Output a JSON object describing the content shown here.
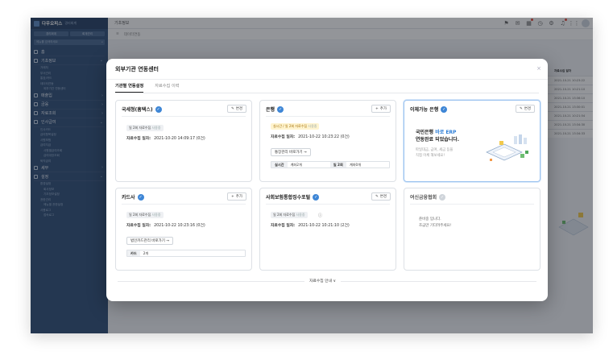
{
  "app": {
    "brand": "다우오피스",
    "brand_sub": "경리회계",
    "tabs": [
      "경리회계",
      "회계관리"
    ],
    "search_placeholder": "메뉴를 검색하세요"
  },
  "sidebar": {
    "items": [
      {
        "label": "홈",
        "subs": []
      },
      {
        "label": "기초정보",
        "subs": [
          "거래처",
          "부서관리",
          "통장/카드",
          "데이터연동"
        ],
        "deep": [
          "외부기관 연동센터"
        ]
      },
      {
        "label": "매출입",
        "subs": []
      },
      {
        "label": "금융",
        "subs": []
      },
      {
        "label": "자료조회",
        "subs": []
      },
      {
        "label": "인사급여",
        "subs": [
          "인사카드",
          "급여항목설정",
          "사원보험",
          "급여지급"
        ],
        "deep2": [
          "사원별급여조회",
          "급여대장조회"
        ],
        "subs2": [
          "퇴직급여"
        ]
      },
      {
        "label": "세무",
        "subs": []
      },
      {
        "label": "설정",
        "subs": [
          "환경설정"
        ],
        "deep3": [
          "회사정보",
          "기초정보설정"
        ],
        "subs3": [
          "권한관리"
        ],
        "deep4": [
          "메뉴별 권한설정"
        ],
        "subs4": [
          "사용로그"
        ],
        "deep5": [
          "접속로그"
        ]
      }
    ]
  },
  "topbar": {
    "breadcrumb": "기초정보",
    "page_tab": "데이터연동",
    "bg_table_header": "자료수집 일자",
    "bg_table_rows": [
      "2021-10-21 10:23:22",
      "2021-10-21 10:21:10",
      "2021-10-21 13:36:10",
      "2021-10-21 13:30:01",
      "2021-10-21 10:21:54",
      "2021-10-21 13:34:30",
      "2021-10-21 13:34:33"
    ]
  },
  "modal": {
    "title": "외부기관 연동센터",
    "close": "×",
    "tabs": [
      "기관별 연동설정",
      "자료수집 이력"
    ],
    "footer": "자료수집 안내 ∨",
    "cards": [
      {
        "title": "국세청(홈택스)",
        "button": "변경",
        "badge": "일 2회 자료수집",
        "badge_soft": "사용중",
        "info_label": "자료수집 일자:",
        "info_value": "2021-10-20 14:09:17 (0건)"
      },
      {
        "title": "은행",
        "button": "추가",
        "badge": "실시간 / 일 2회 자료수집",
        "badge_soft": "사용중",
        "info_label": "자료수집 일자:",
        "info_value": "2021-10-22 10:23:22 (0건)",
        "link": "통장관리 바로가기 →",
        "kv": [
          {
            "k": "실시간",
            "v": "계좌2개"
          },
          {
            "k": "일 2회",
            "v": "계좌0개"
          }
        ]
      },
      {
        "title": "이체가능 은행",
        "button": "변경",
        "promo_pre": "국민은행",
        "promo_blue": "바로 ERP",
        "promo_line2": "연동완료 되었습니다.",
        "promo_sub1": "파일대금, 급여, 세금 등을",
        "promo_sub2": "직접 이체 해보세요!"
      },
      {
        "title": "카드사",
        "button": "추가",
        "badge": "일 2회 자료수집",
        "badge_soft": "사용중",
        "info_label": "자료수집 일자:",
        "info_value": "2021-10-22 10:23:16 (0건)",
        "link": "법인카드관리 바로가기 →",
        "kv": [
          {
            "k": "카드",
            "v": "2개"
          }
        ]
      },
      {
        "title": "사회보험통합징수포털",
        "button": "변경",
        "badge": "일 2회 자료수집",
        "badge_soft": "사용중",
        "info_label": "자료수집 일자:",
        "info_value": "2021-10-22 10:21:10 (2건)"
      },
      {
        "title": "여신금융협회",
        "prep1": "준비중 입니다.",
        "prep2": "조금만 기다려주세요!"
      }
    ]
  }
}
